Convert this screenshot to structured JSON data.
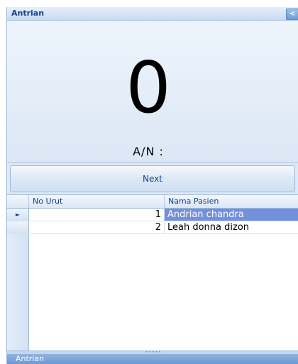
{
  "panel": {
    "title": "Antrian",
    "collapse_glyph": "<"
  },
  "display": {
    "current_number": "0",
    "an_label": "A/N :"
  },
  "actions": {
    "next_label": "Next"
  },
  "grid": {
    "columns": [
      "No Urut",
      "Nama Pasien"
    ],
    "rows": [
      {
        "no_urut": "1",
        "nama_pasien": "Andrian chandra",
        "selected": true
      },
      {
        "no_urut": "2",
        "nama_pasien": "Leah donna dizon",
        "selected": false
      }
    ]
  },
  "status_bar": {
    "label": "Antrian"
  },
  "colors": {
    "title_text": "#15428b",
    "selection": "#7390dd",
    "status_bar": "#6f98d3"
  },
  "icons": {
    "collapse": "chevron-left-icon",
    "row_pointer": "row-pointer-icon"
  }
}
